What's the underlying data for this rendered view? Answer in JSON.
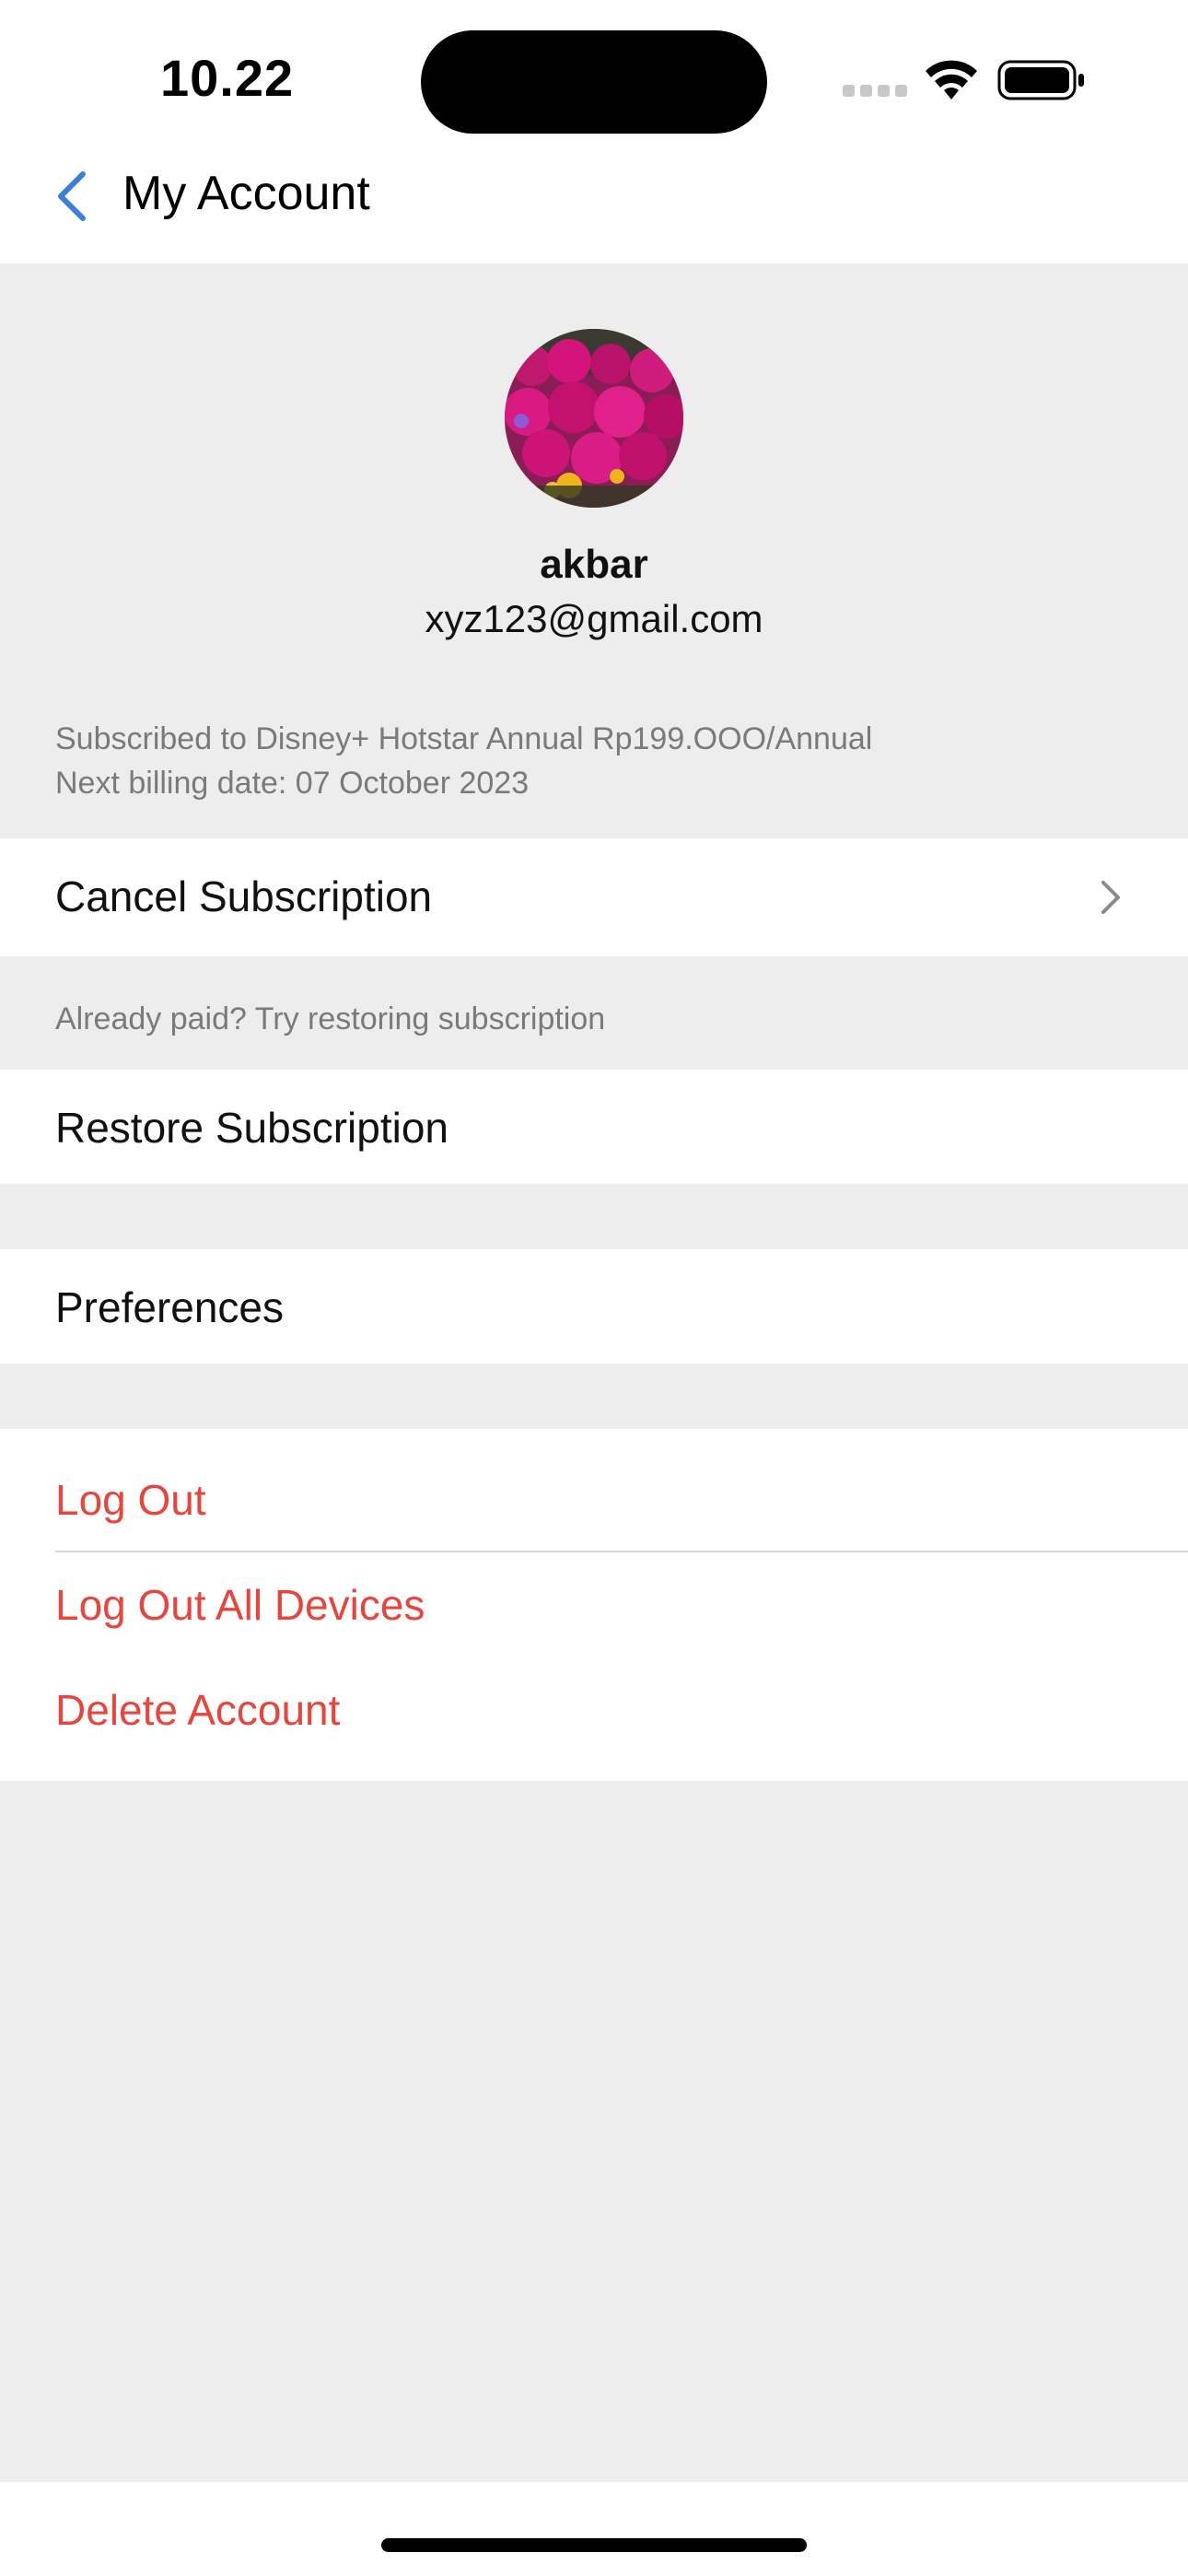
{
  "status_bar": {
    "time": "10.22"
  },
  "nav": {
    "title": "My Account",
    "back_icon": "chevron-left-icon"
  },
  "profile": {
    "name": "akbar",
    "email": "xyz123@gmail.com"
  },
  "subscription": {
    "line1": "Subscribed to Disney+ Hotstar Annual Rp199.OOO/Annual",
    "line2": "Next billing date: 07 October 2023",
    "cancel_label": "Cancel Subscription",
    "restore_note": "Already paid? Try restoring subscription",
    "restore_label": "Restore Subscription"
  },
  "preferences": {
    "label": "Preferences"
  },
  "account_actions": {
    "logout": "Log Out",
    "logout_all": "Log Out All Devices",
    "delete": "Delete Account"
  },
  "colors": {
    "accent_blue": "#3b7fd6",
    "danger_red": "#e8453c",
    "background": "#ededed"
  }
}
